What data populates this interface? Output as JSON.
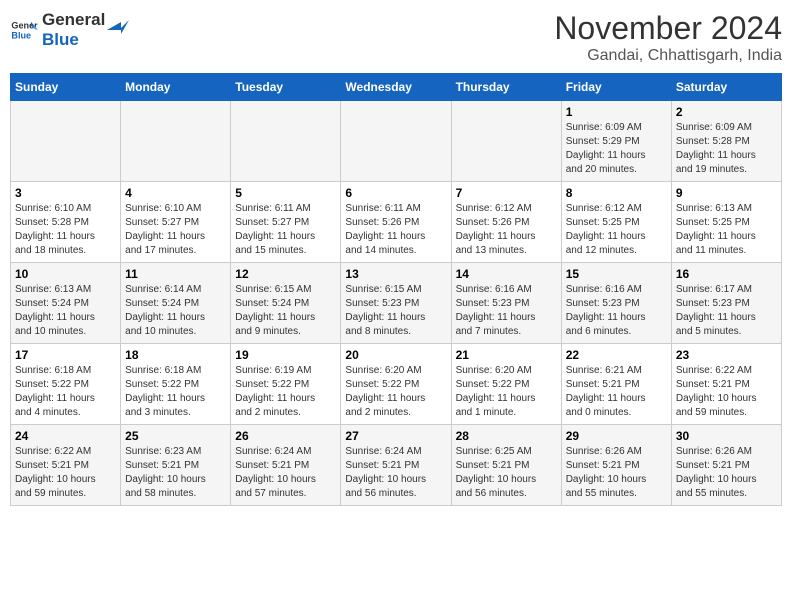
{
  "header": {
    "logo_general": "General",
    "logo_blue": "Blue",
    "month_title": "November 2024",
    "subtitle": "Gandai, Chhattisgarh, India"
  },
  "weekdays": [
    "Sunday",
    "Monday",
    "Tuesday",
    "Wednesday",
    "Thursday",
    "Friday",
    "Saturday"
  ],
  "weeks": [
    [
      {
        "day": "",
        "info": ""
      },
      {
        "day": "",
        "info": ""
      },
      {
        "day": "",
        "info": ""
      },
      {
        "day": "",
        "info": ""
      },
      {
        "day": "",
        "info": ""
      },
      {
        "day": "1",
        "info": "Sunrise: 6:09 AM\nSunset: 5:29 PM\nDaylight: 11 hours\nand 20 minutes."
      },
      {
        "day": "2",
        "info": "Sunrise: 6:09 AM\nSunset: 5:28 PM\nDaylight: 11 hours\nand 19 minutes."
      }
    ],
    [
      {
        "day": "3",
        "info": "Sunrise: 6:10 AM\nSunset: 5:28 PM\nDaylight: 11 hours\nand 18 minutes."
      },
      {
        "day": "4",
        "info": "Sunrise: 6:10 AM\nSunset: 5:27 PM\nDaylight: 11 hours\nand 17 minutes."
      },
      {
        "day": "5",
        "info": "Sunrise: 6:11 AM\nSunset: 5:27 PM\nDaylight: 11 hours\nand 15 minutes."
      },
      {
        "day": "6",
        "info": "Sunrise: 6:11 AM\nSunset: 5:26 PM\nDaylight: 11 hours\nand 14 minutes."
      },
      {
        "day": "7",
        "info": "Sunrise: 6:12 AM\nSunset: 5:26 PM\nDaylight: 11 hours\nand 13 minutes."
      },
      {
        "day": "8",
        "info": "Sunrise: 6:12 AM\nSunset: 5:25 PM\nDaylight: 11 hours\nand 12 minutes."
      },
      {
        "day": "9",
        "info": "Sunrise: 6:13 AM\nSunset: 5:25 PM\nDaylight: 11 hours\nand 11 minutes."
      }
    ],
    [
      {
        "day": "10",
        "info": "Sunrise: 6:13 AM\nSunset: 5:24 PM\nDaylight: 11 hours\nand 10 minutes."
      },
      {
        "day": "11",
        "info": "Sunrise: 6:14 AM\nSunset: 5:24 PM\nDaylight: 11 hours\nand 10 minutes."
      },
      {
        "day": "12",
        "info": "Sunrise: 6:15 AM\nSunset: 5:24 PM\nDaylight: 11 hours\nand 9 minutes."
      },
      {
        "day": "13",
        "info": "Sunrise: 6:15 AM\nSunset: 5:23 PM\nDaylight: 11 hours\nand 8 minutes."
      },
      {
        "day": "14",
        "info": "Sunrise: 6:16 AM\nSunset: 5:23 PM\nDaylight: 11 hours\nand 7 minutes."
      },
      {
        "day": "15",
        "info": "Sunrise: 6:16 AM\nSunset: 5:23 PM\nDaylight: 11 hours\nand 6 minutes."
      },
      {
        "day": "16",
        "info": "Sunrise: 6:17 AM\nSunset: 5:23 PM\nDaylight: 11 hours\nand 5 minutes."
      }
    ],
    [
      {
        "day": "17",
        "info": "Sunrise: 6:18 AM\nSunset: 5:22 PM\nDaylight: 11 hours\nand 4 minutes."
      },
      {
        "day": "18",
        "info": "Sunrise: 6:18 AM\nSunset: 5:22 PM\nDaylight: 11 hours\nand 3 minutes."
      },
      {
        "day": "19",
        "info": "Sunrise: 6:19 AM\nSunset: 5:22 PM\nDaylight: 11 hours\nand 2 minutes."
      },
      {
        "day": "20",
        "info": "Sunrise: 6:20 AM\nSunset: 5:22 PM\nDaylight: 11 hours\nand 2 minutes."
      },
      {
        "day": "21",
        "info": "Sunrise: 6:20 AM\nSunset: 5:22 PM\nDaylight: 11 hours\nand 1 minute."
      },
      {
        "day": "22",
        "info": "Sunrise: 6:21 AM\nSunset: 5:21 PM\nDaylight: 11 hours\nand 0 minutes."
      },
      {
        "day": "23",
        "info": "Sunrise: 6:22 AM\nSunset: 5:21 PM\nDaylight: 10 hours\nand 59 minutes."
      }
    ],
    [
      {
        "day": "24",
        "info": "Sunrise: 6:22 AM\nSunset: 5:21 PM\nDaylight: 10 hours\nand 59 minutes."
      },
      {
        "day": "25",
        "info": "Sunrise: 6:23 AM\nSunset: 5:21 PM\nDaylight: 10 hours\nand 58 minutes."
      },
      {
        "day": "26",
        "info": "Sunrise: 6:24 AM\nSunset: 5:21 PM\nDaylight: 10 hours\nand 57 minutes."
      },
      {
        "day": "27",
        "info": "Sunrise: 6:24 AM\nSunset: 5:21 PM\nDaylight: 10 hours\nand 56 minutes."
      },
      {
        "day": "28",
        "info": "Sunrise: 6:25 AM\nSunset: 5:21 PM\nDaylight: 10 hours\nand 56 minutes."
      },
      {
        "day": "29",
        "info": "Sunrise: 6:26 AM\nSunset: 5:21 PM\nDaylight: 10 hours\nand 55 minutes."
      },
      {
        "day": "30",
        "info": "Sunrise: 6:26 AM\nSunset: 5:21 PM\nDaylight: 10 hours\nand 55 minutes."
      }
    ]
  ]
}
